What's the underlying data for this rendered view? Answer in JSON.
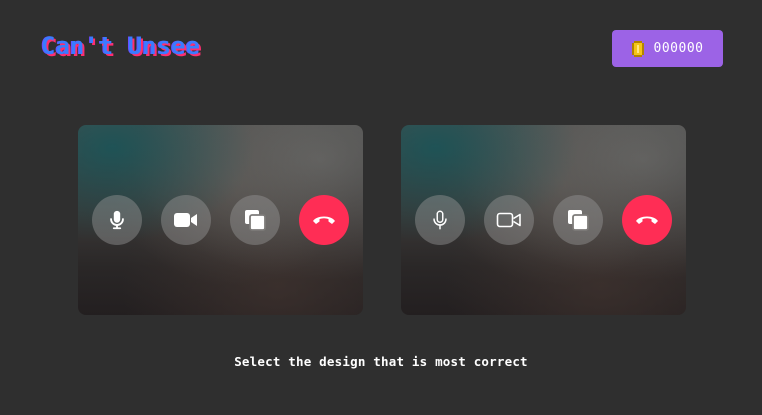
{
  "header": {
    "logo_text": "Can't Unsee",
    "coin_count": "000000",
    "coin_icon": "coin-icon"
  },
  "options": [
    {
      "name": "design-option-a",
      "buttons": [
        {
          "icon": "microphone-icon",
          "style": "filled"
        },
        {
          "icon": "video-camera-icon",
          "style": "filled"
        },
        {
          "icon": "screen-share-icon",
          "style": "filled"
        },
        {
          "icon": "end-call-icon",
          "style": "filled"
        }
      ]
    },
    {
      "name": "design-option-b",
      "buttons": [
        {
          "icon": "microphone-icon",
          "style": "outline"
        },
        {
          "icon": "video-camera-icon",
          "style": "outline"
        },
        {
          "icon": "screen-share-icon",
          "style": "filled"
        },
        {
          "icon": "end-call-icon",
          "style": "filled"
        }
      ]
    }
  ],
  "instruction": "Select the design that is most correct",
  "colors": {
    "background": "#2f2f2f",
    "coin_box": "#9c63e6",
    "end_call": "#ff2d55",
    "logo_primary": "#3a7bff",
    "logo_shadow": "#ff2d6f"
  }
}
